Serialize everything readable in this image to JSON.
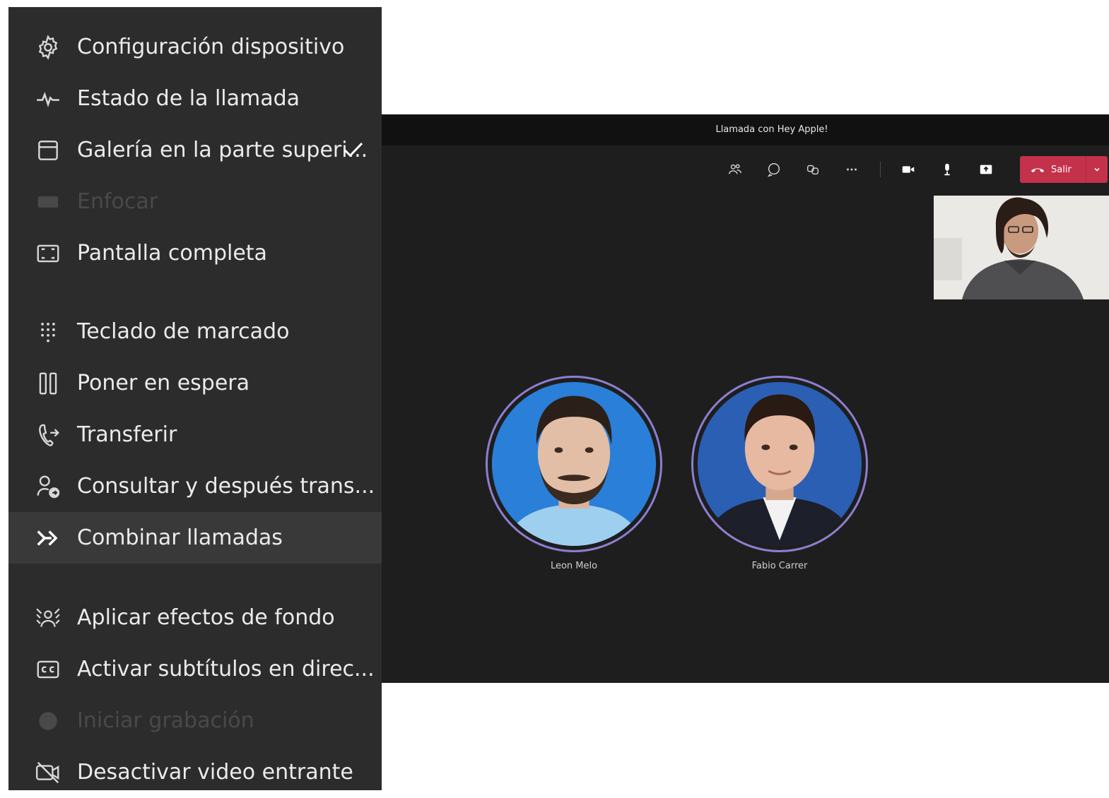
{
  "window": {
    "title": "Llamada con Hey Apple!"
  },
  "toolbar": {
    "buttons": [
      {
        "name": "participants-icon"
      },
      {
        "name": "chat-icon"
      },
      {
        "name": "reactions-icon"
      },
      {
        "name": "more-actions-icon"
      },
      {
        "name": "camera-icon"
      },
      {
        "name": "microphone-icon"
      },
      {
        "name": "share-screen-icon"
      }
    ],
    "leave_label": "Salir"
  },
  "participants": [
    {
      "name": "Leon Melo"
    },
    {
      "name": "Fabio Carrer"
    }
  ],
  "menu": {
    "items": [
      {
        "label": "Configuración dispositivo",
        "icon": "gear-icon"
      },
      {
        "label": "Estado de la llamada",
        "icon": "pulse-icon"
      },
      {
        "label": "Galería en la parte superi...",
        "icon": "gallery-top-icon",
        "checked": true
      },
      {
        "label": "Enfocar",
        "icon": "focus-icon",
        "disabled": true
      },
      {
        "label": "Pantalla completa",
        "icon": "fullscreen-icon"
      },
      {
        "label": "Teclado de marcado",
        "icon": "dialpad-icon"
      },
      {
        "label": "Poner en espera",
        "icon": "pause-icon"
      },
      {
        "label": "Transferir",
        "icon": "transfer-icon"
      },
      {
        "label": "Consultar y después trans...",
        "icon": "consult-transfer-icon"
      },
      {
        "label": "Combinar llamadas",
        "icon": "merge-calls-icon",
        "highlighted": true
      },
      {
        "label": "Aplicar efectos de fondo",
        "icon": "background-effects-icon"
      },
      {
        "label": "Activar subtítulos en direc...",
        "icon": "captions-icon"
      },
      {
        "label": "Iniciar grabación",
        "icon": "record-icon",
        "disabled": true
      },
      {
        "label": "Desactivar video entrante",
        "icon": "video-off-icon"
      }
    ]
  },
  "colors": {
    "menu_bg": "#2d2c2c",
    "menu_text": "#ebebeb",
    "call_bg": "#1e1e1e",
    "leave_red": "#c4314b",
    "avatar_ring": "#8b7fd0"
  }
}
